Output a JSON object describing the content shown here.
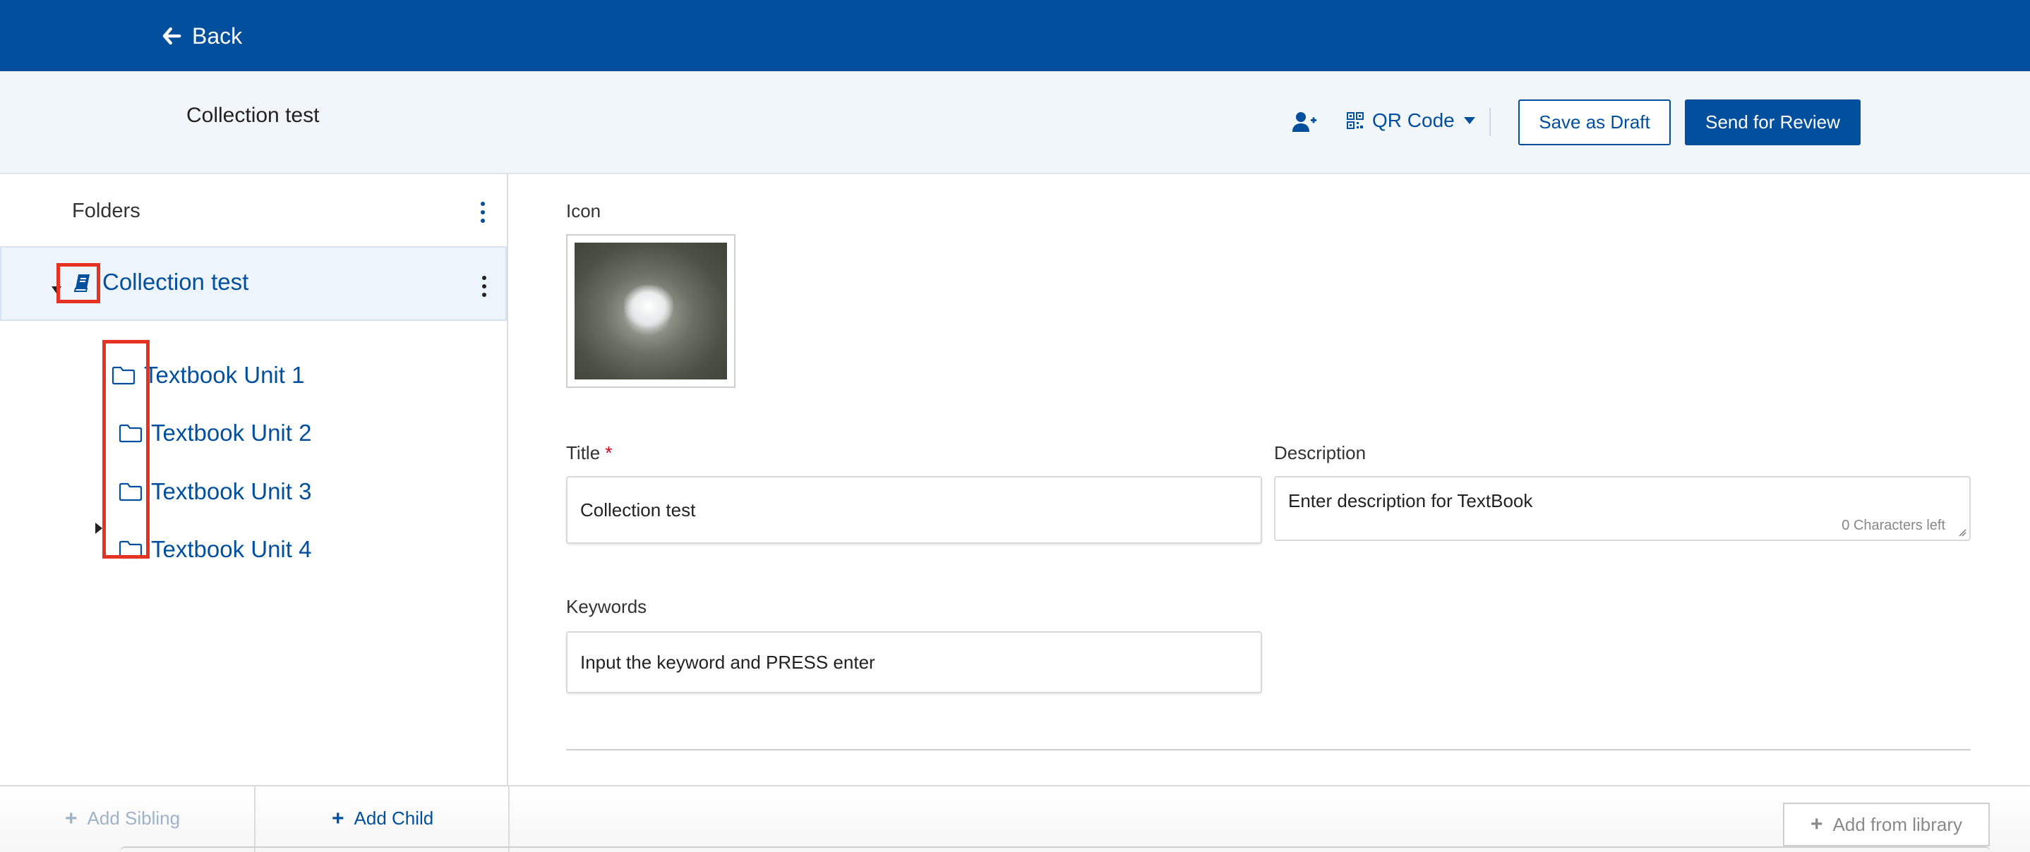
{
  "topbar": {
    "back_label": "Back"
  },
  "header": {
    "title": "Collection test",
    "qr_label": "QR Code",
    "save_draft_label": "Save as Draft",
    "send_review_label": "Send for Review"
  },
  "tree": {
    "heading": "Folders",
    "root": {
      "label": "Collection test"
    },
    "children": [
      {
        "label": "Textbook Unit 1"
      },
      {
        "label": "Textbook Unit 2"
      },
      {
        "label": "Textbook Unit 3"
      },
      {
        "label": "Textbook Unit 4"
      }
    ]
  },
  "form": {
    "icon_label": "Icon",
    "title_label": "Title",
    "title_required_mark": "*",
    "title_value": "Collection test",
    "description_label": "Description",
    "description_placeholder": "Enter description for TextBook",
    "characters_left": "0 Characters left",
    "keywords_label": "Keywords",
    "keywords_placeholder": "Input the keyword and PRESS enter"
  },
  "bottombar": {
    "add_sibling_label": "Add Sibling",
    "add_child_label": "Add Child",
    "add_library_label": "Add from library"
  },
  "colors": {
    "brand": "#024f9d",
    "highlight": "#e53222",
    "required": "#d0021b"
  },
  "icons": [
    "arrow-left-icon",
    "add-user-icon",
    "qr-code-icon",
    "caret-down-icon",
    "kebab-icon",
    "book-icon",
    "folder-icon",
    "caret-right-icon",
    "plus-icon"
  ]
}
